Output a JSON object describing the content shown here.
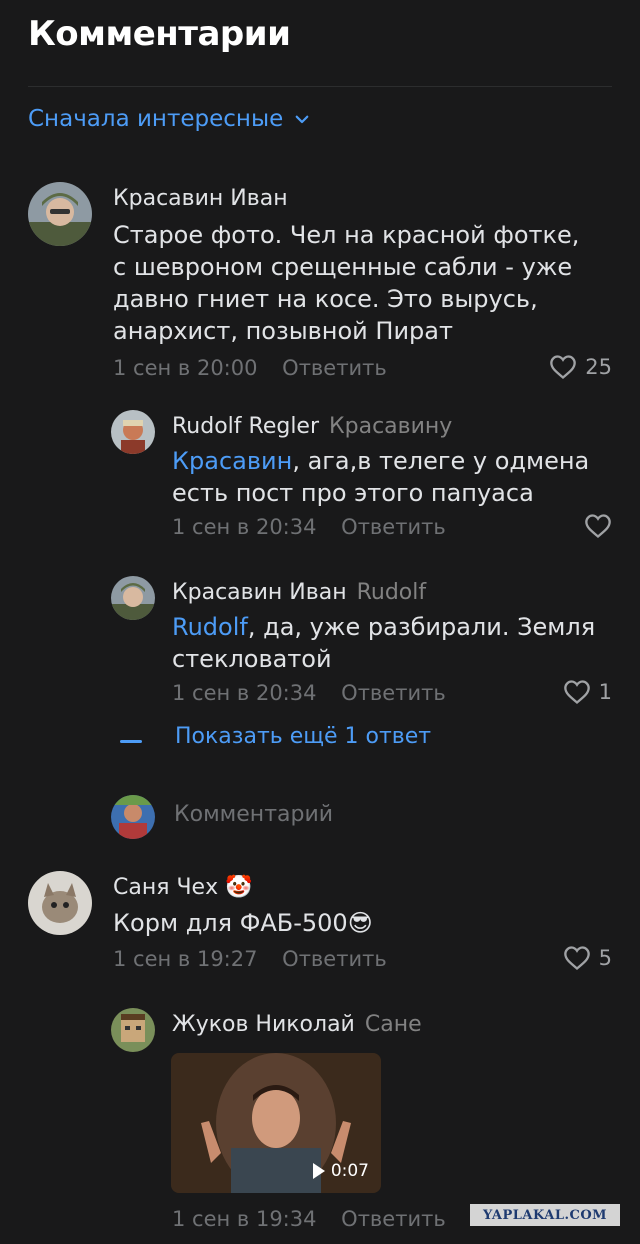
{
  "header": {
    "title": "Комментарии"
  },
  "sort": {
    "label": "Сначала интересные"
  },
  "comments": [
    {
      "author": "Красавин Иван",
      "text": "Старое фото. Чел на красной фотке, с шевроном срещенные сабли - уже давно гниет на косе. Это вырусь, анархист, позывной Пират",
      "time": "1 сен в 20:00",
      "reply_label": "Ответить",
      "likes": "25"
    },
    {
      "author": "Rudolf Regler",
      "reply_to": "Красавину",
      "mention": "Красавин",
      "text": ", ага,в телеге у одмена есть пост про этого папуаса",
      "time": "1 сен в 20:34",
      "reply_label": "Ответить",
      "likes": ""
    },
    {
      "author": "Красавин Иван",
      "reply_to": "Rudolf",
      "mention": "Rudolf",
      "text": ", да, уже разбирали. Земля стекловатой",
      "time": "1 сен в 20:34",
      "reply_label": "Ответить",
      "likes": "1"
    },
    {
      "author": "Саня Чех",
      "author_emoji": "🤡",
      "text": "Корм для ФАБ-500",
      "text_emoji": "😎",
      "time": "1 сен в 19:27",
      "reply_label": "Ответить",
      "likes": "5"
    },
    {
      "author": "Жуков Николай",
      "reply_to": "Сане",
      "video_duration": "0:07",
      "time": "1 сен в 19:34",
      "reply_label": "Ответить"
    }
  ],
  "show_more": {
    "label": "Показать ещё 1 ответ"
  },
  "comment_input": {
    "placeholder": "Комментарий"
  },
  "watermark": "YAPLAKAL.COM",
  "colors": {
    "background": "#19191a",
    "accent": "#4d9cf6",
    "text": "#e1e3e6",
    "secondary": "#6f7174"
  }
}
